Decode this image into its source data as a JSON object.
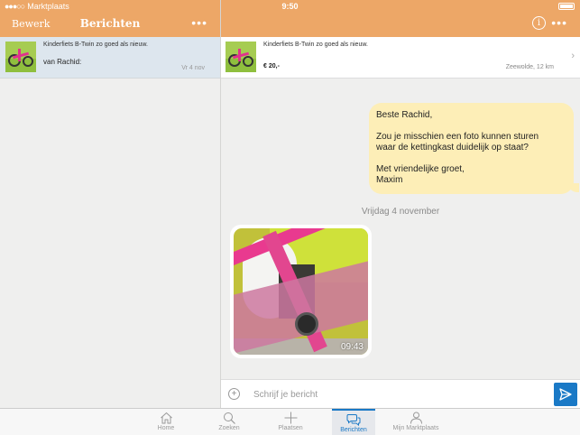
{
  "status_bar": {
    "carrier": "Marktplaats",
    "time": "9:50"
  },
  "left_header": {
    "edit_label": "Bewerk",
    "title": "Berichten",
    "more_label": "•••"
  },
  "right_header": {
    "info_label": "i",
    "more_label": "•••"
  },
  "conversations": [
    {
      "subject": "Kinderfiets B-Twin zo goed als nieuw.",
      "from": "van Rachid:",
      "date": "Vr 4 nov"
    }
  ],
  "item": {
    "title": "Kinderfiets B-Twin zo goed als nieuw.",
    "price": "€ 20,-",
    "location": "Zeewolde, 12 km"
  },
  "messages": {
    "outgoing": {
      "lines": [
        "Beste Rachid,",
        "Zou je misschien een foto kunnen sturen",
        "waar de kettingkast duidelijk op staat?",
        "Met vriendelijke groet,",
        "Maxim"
      ]
    },
    "day_separator": "Vrijdag 4 november",
    "incoming_photo": {
      "time": "09:43"
    }
  },
  "compose": {
    "placeholder": "Schrijf je bericht",
    "value": ""
  },
  "tabs": [
    {
      "label": "Home",
      "icon": "home-icon",
      "active": false
    },
    {
      "label": "Zoeken",
      "icon": "search-icon",
      "active": false
    },
    {
      "label": "Plaatsen",
      "icon": "plus-icon",
      "active": false
    },
    {
      "label": "Berichten",
      "icon": "chat-icon",
      "active": true
    },
    {
      "label": "Mijn Marktplaats",
      "icon": "user-icon",
      "active": false
    }
  ],
  "colors": {
    "header": "#eda767",
    "accent": "#1a79c6",
    "outgoing_bubble": "#fdeeb7",
    "selected_row": "#dde6ee"
  }
}
